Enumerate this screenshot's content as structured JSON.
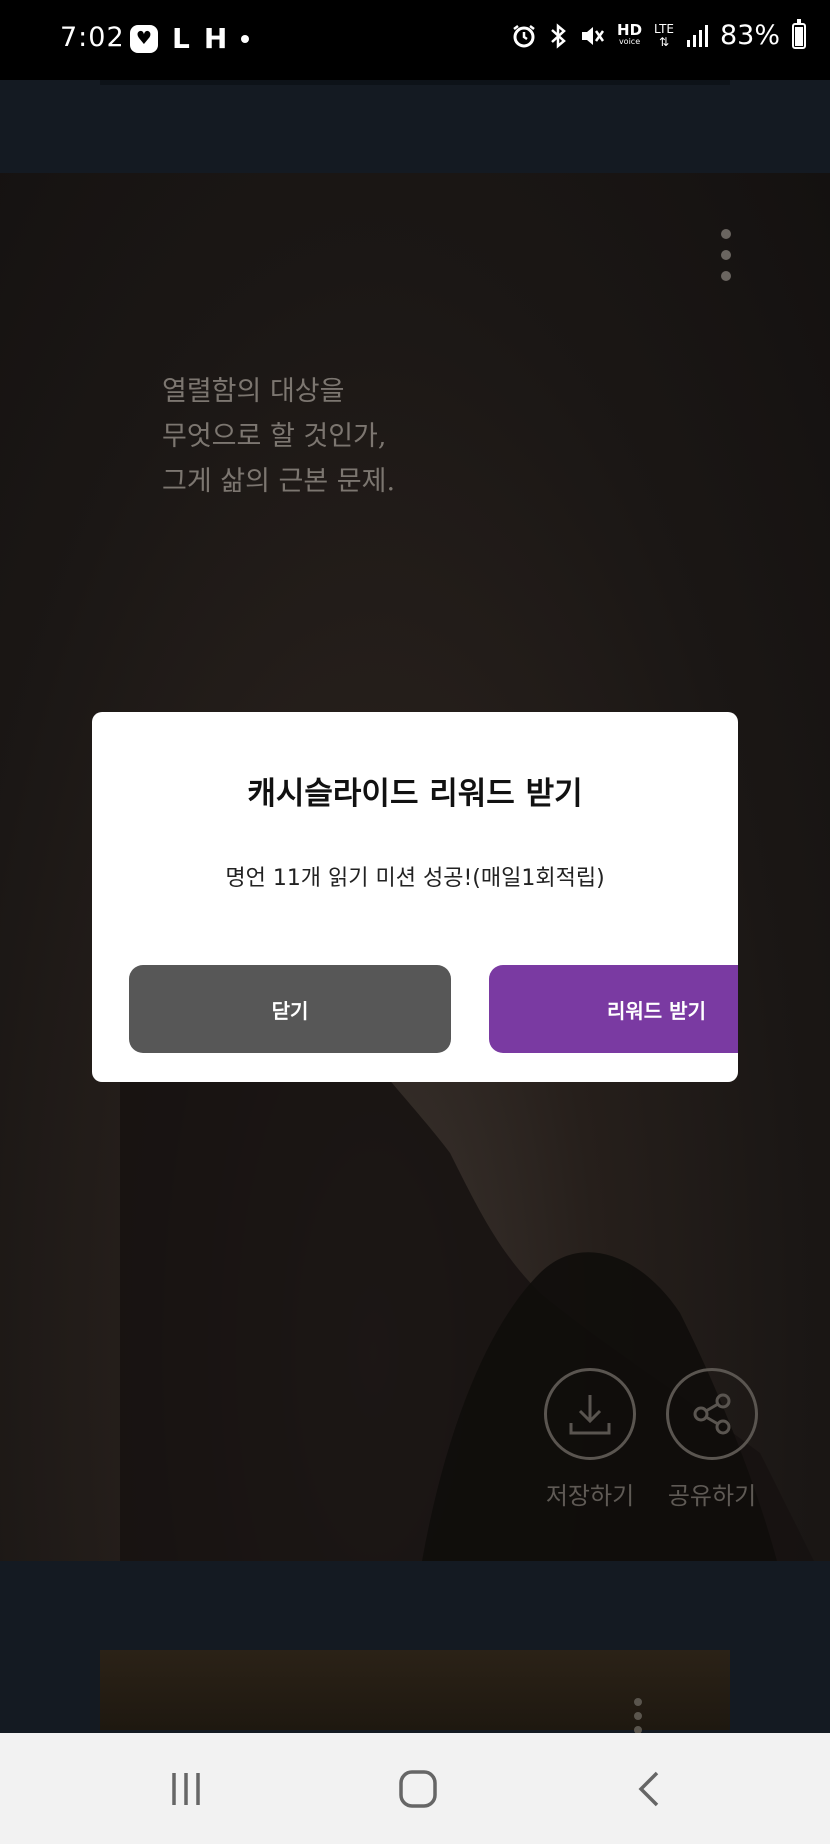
{
  "status_bar": {
    "time": "7:02",
    "left_icons": [
      "heart-app-icon",
      "L",
      "H",
      "dot"
    ],
    "battery": "83%",
    "battery_level": 0.83,
    "right_icons": [
      "alarm-icon",
      "bluetooth-icon",
      "mute-icon",
      "hd-voice-icon",
      "lte-icon",
      "signal-icon",
      "battery-icon"
    ],
    "hd_label": "HD",
    "voice_label": "voice",
    "lte_label": "LTE"
  },
  "background_faint_text": "저장하기 공유하기",
  "quote_card": {
    "lines": [
      "열렬함의 대상을",
      "무엇으로 할 것인가,",
      "그게 삶의 근본 문제."
    ],
    "save_label": "저장하기",
    "share_label": "공유하기"
  },
  "dialog": {
    "title": "캐시슬라이드 리워드 받기",
    "message": "명언 11개 읽기 미션 성공!(매일1회적립)",
    "close_label": "닫기",
    "reward_label": "리워드 받기"
  },
  "colors": {
    "reward_button": "#7a3aa2",
    "close_button": "#575757",
    "page_background": "#141a22"
  }
}
